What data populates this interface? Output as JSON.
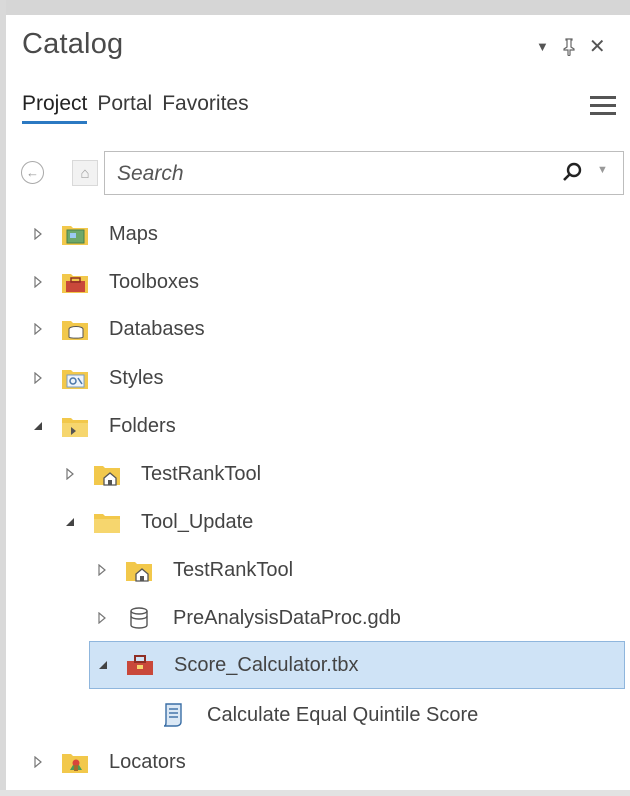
{
  "window": {
    "title": "Catalog"
  },
  "tabs": [
    {
      "label": "Project",
      "active": true
    },
    {
      "label": "Portal"
    },
    {
      "label": "Favorites"
    }
  ],
  "search": {
    "placeholder": "Search"
  },
  "tree": [
    {
      "label": "Maps",
      "icon": "maps-folder-icon",
      "expanded": false
    },
    {
      "label": "Toolboxes",
      "icon": "toolboxes-folder-icon",
      "expanded": false
    },
    {
      "label": "Databases",
      "icon": "databases-folder-icon",
      "expanded": false
    },
    {
      "label": "Styles",
      "icon": "styles-folder-icon",
      "expanded": false
    },
    {
      "label": "Folders",
      "icon": "folders-folder-icon",
      "expanded": true
    },
    {
      "label": "TestRankTool",
      "icon": "folder-connection-icon",
      "expanded": false
    },
    {
      "label": "Tool_Update",
      "icon": "folder-icon",
      "expanded": true
    },
    {
      "label": "TestRankTool",
      "icon": "folder-connection-icon",
      "expanded": false
    },
    {
      "label": "PreAnalysisDataProc.gdb",
      "icon": "geodatabase-icon",
      "expanded": false
    },
    {
      "label": "Score_Calculator.tbx",
      "icon": "toolbox-icon",
      "expanded": true,
      "selected": true
    },
    {
      "label": "Calculate Equal Quintile Score",
      "icon": "script-tool-icon"
    },
    {
      "label": "Locators",
      "icon": "locators-folder-icon",
      "expanded": false
    }
  ],
  "colors": {
    "tab_underline": "#2b79c2",
    "selection_bg": "#cfe3f6",
    "selection_border": "#8fb6dd",
    "folder": "#f2c84b"
  }
}
